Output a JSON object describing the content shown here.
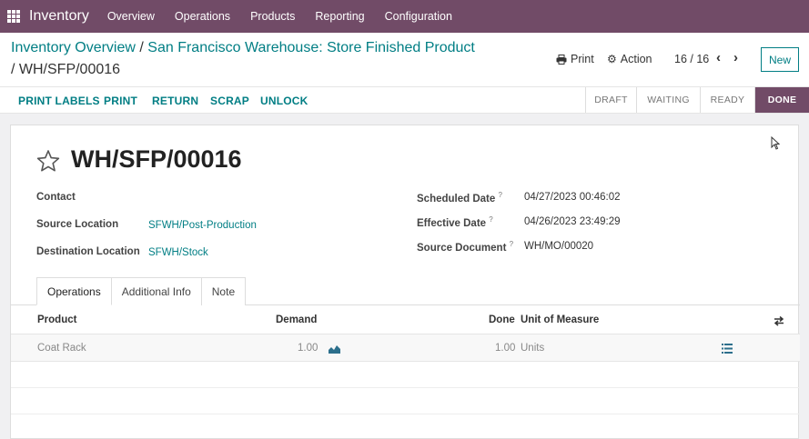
{
  "navbar": {
    "brand": "Inventory",
    "menu": [
      "Overview",
      "Operations",
      "Products",
      "Reporting",
      "Configuration"
    ]
  },
  "breadcrumb": {
    "parent": "Inventory Overview",
    "middle": "San Francisco Warehouse: Store Finished Product",
    "current": "WH/SFP/00016"
  },
  "control": {
    "print": "Print",
    "action": "Action",
    "pager": "16 / 16",
    "new": "New"
  },
  "statusbar": {
    "buttons": [
      "PRINT LABELS",
      "PRINT",
      "RETURN",
      "SCRAP",
      "UNLOCK"
    ],
    "stages": [
      "DRAFT",
      "WAITING",
      "READY",
      "DONE"
    ],
    "active_stage": "DONE"
  },
  "record": {
    "title": "WH/SFP/00016",
    "contact_label": "Contact",
    "source_label": "Source Location",
    "source_value": "SFWH/Post-Production",
    "dest_label": "Destination Location",
    "dest_value": "SFWH/Stock",
    "scheduled_label": "Scheduled Date",
    "scheduled_value": "04/27/2023 00:46:02",
    "effective_label": "Effective Date",
    "effective_value": "04/26/2023 23:49:29",
    "srcdoc_label": "Source Document",
    "srcdoc_value": "WH/MO/00020",
    "help_mark": "?"
  },
  "tabs": [
    "Operations",
    "Additional Info",
    "Note"
  ],
  "table": {
    "headers": {
      "product": "Product",
      "demand": "Demand",
      "done": "Done",
      "uom": "Unit of Measure"
    },
    "rows": [
      {
        "product": "Coat Rack",
        "demand": "1.00",
        "done": "1.00",
        "uom": "Units"
      }
    ]
  },
  "colors": {
    "brand": "#714b67",
    "link": "#017e84"
  }
}
